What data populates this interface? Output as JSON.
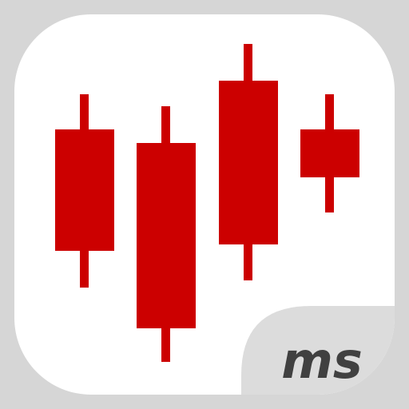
{
  "app_icon": {
    "brand_mark": "ms",
    "colors": {
      "tile": "#ffffff",
      "outer": "#d6d6d6",
      "candle": "#cc0000",
      "corner_panel": "#dcdcdc",
      "brand_text": "#404040"
    },
    "icon_semantics": "candlestick-chart-icon"
  }
}
